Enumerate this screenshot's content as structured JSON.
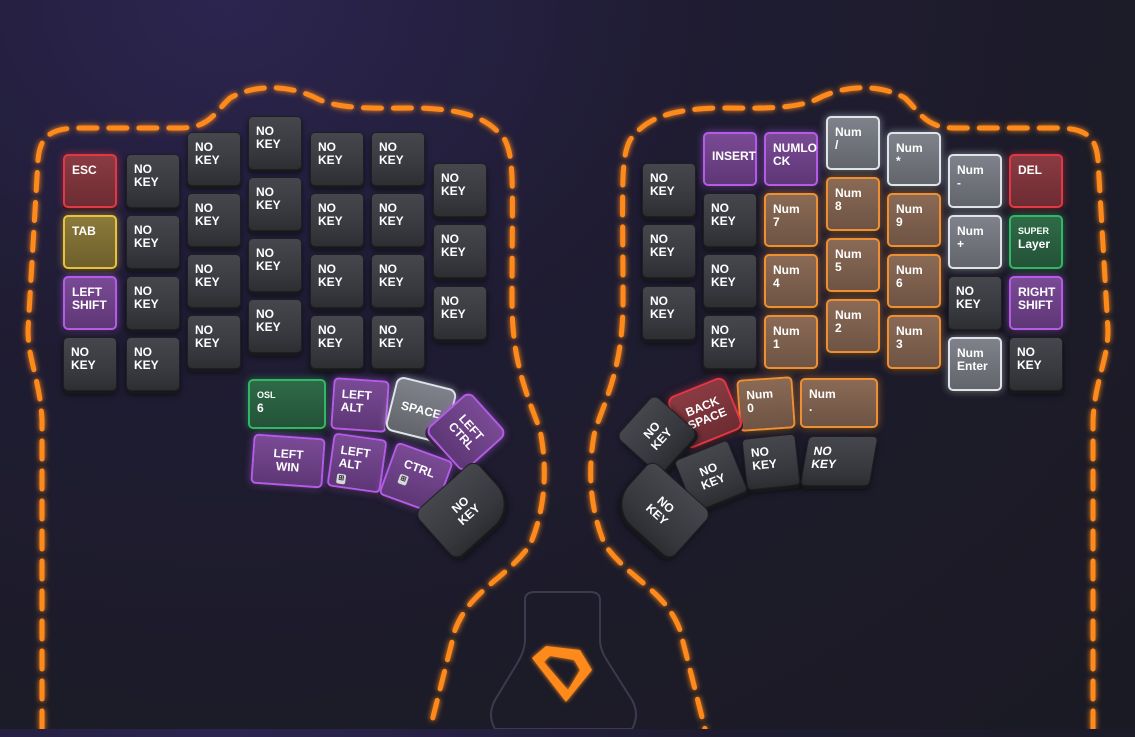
{
  "colors": {
    "outline": "#ff8a1f",
    "key_default": "#3b3d42",
    "red": "#e03945",
    "yellow": "#e6c33a",
    "purple": "#b45ce8",
    "green": "#32b865",
    "orange": "#ef8f33",
    "white": "#dfe3ea"
  },
  "left_half": {
    "keys": {
      "esc": "ESC",
      "tab": "TAB",
      "left_shift": "LEFT\nSHIFT",
      "no_key": "NO\nKEY"
    },
    "thumb": {
      "osl": "OSL",
      "osl_num": "6",
      "left_alt_top": "LEFT\nALT",
      "space": "SPACE",
      "left_ctrl": "LEFT\nCTRL",
      "left_win": "LEFT\nWIN",
      "left_alt": "LEFT\nALT",
      "ctrl": "CTRL",
      "no_key": "NO\nKEY"
    }
  },
  "right_half": {
    "keys": {
      "insert": "INSERT",
      "numlock": "NUMLO\nCK",
      "num_slash": "Num\n/",
      "num_star": "Num\n*",
      "num_minus": "Num\n-",
      "del": "DEL",
      "num_8": "Num\n8",
      "num_7": "Num\n7",
      "num_9": "Num\n9",
      "num_plus": "Num\n+",
      "super_small": "SUPER",
      "super_big": "Layer",
      "num_5": "Num\n5",
      "num_4": "Num\n4",
      "num_6": "Num\n6",
      "right_shift": "RIGHT\nSHIFT",
      "num_2": "Num\n2",
      "num_1": "Num\n1",
      "num_3": "Num\n3",
      "num_enter": "Num\nEnter",
      "no_key": "NO\nKEY"
    },
    "thumb": {
      "backspace": "BACK\nSPACE",
      "num_0": "Num\n0",
      "num_dot": "Num\n.",
      "no_key": "NO\nKEY"
    }
  },
  "icons": {
    "logo": "shield-logo-icon",
    "modifier_badge": "os-badge-icon"
  }
}
